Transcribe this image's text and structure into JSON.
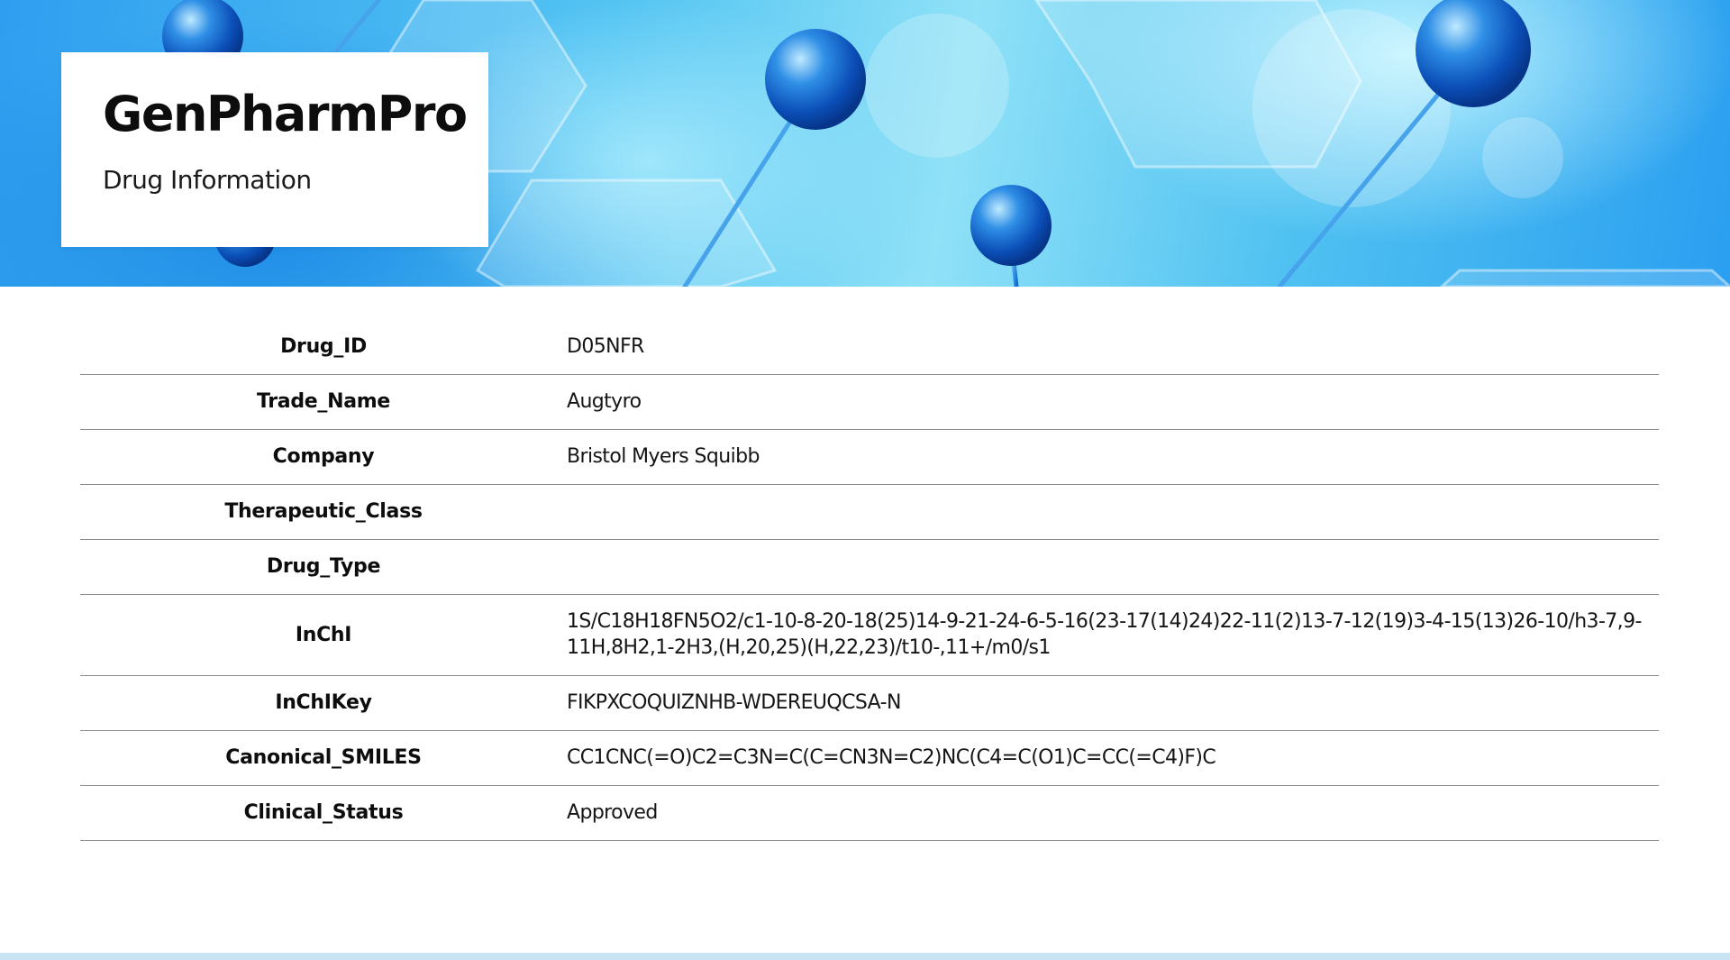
{
  "header": {
    "app_title": "GenPharmPro",
    "app_subtitle": "Drug Information",
    "accent_color": "#2f9ef0"
  },
  "drug_info": {
    "rows": [
      {
        "key": "Drug_ID",
        "value": "D05NFR"
      },
      {
        "key": "Trade_Name",
        "value": "Augtyro"
      },
      {
        "key": "Company",
        "value": "Bristol Myers Squibb"
      },
      {
        "key": "Therapeutic_Class",
        "value": ""
      },
      {
        "key": "Drug_Type",
        "value": ""
      },
      {
        "key": "InChI",
        "value": "1S/C18H18FN5O2/c1-10-8-20-18(25)14-9-21-24-6-5-16(23-17(14)24)22-11(2)13-7-12(19)3-4-15(13)26-10/h3-7,9-11H,8H2,1-2H3,(H,20,25)(H,22,23)/t10-,11+/m0/s1"
      },
      {
        "key": "InChIKey",
        "value": "FIKPXCOQUIZNHB-WDEREUQCSA-N"
      },
      {
        "key": "Canonical_SMILES",
        "value": "CC1CNC(=O)C2=C3N=C(C=CN3N=C2)NC(C4=C(O1)C=CC(=C4)F)C"
      },
      {
        "key": "Clinical_Status",
        "value": "Approved"
      }
    ]
  }
}
